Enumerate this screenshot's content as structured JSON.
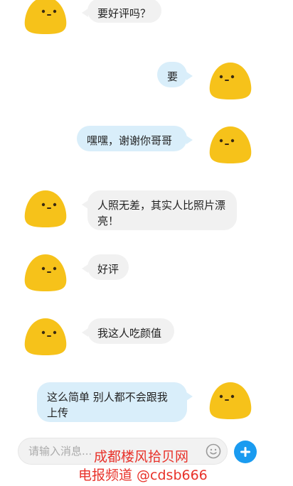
{
  "messages": [
    {
      "side": "left",
      "text": "要好评吗？"
    },
    {
      "side": "right",
      "text": "要"
    },
    {
      "side": "right",
      "text": "嘿嘿，谢谢你哥哥"
    },
    {
      "side": "left",
      "text": "人照无差，其实人比照片漂亮！"
    },
    {
      "side": "left",
      "text": "好评"
    },
    {
      "side": "left",
      "text": "我这人吃颜值"
    },
    {
      "side": "right",
      "text": "这么简单 别人都不会跟我上传"
    }
  ],
  "input": {
    "placeholder": "请输入消息..."
  },
  "icons": {
    "emoji": "smiley-face-icon",
    "add": "plus-icon",
    "avatar": "yellow-blob-avatar-icon"
  },
  "colors": {
    "left_bubble": "#f1f1f1",
    "right_bubble": "#d9eefa",
    "accent": "#1a9bf0",
    "avatar": "#f6c21a",
    "watermark": "#e8322a"
  },
  "watermark": {
    "line1": "成都楼风拾贝网",
    "line2": "电报频道 @cdsb666"
  }
}
